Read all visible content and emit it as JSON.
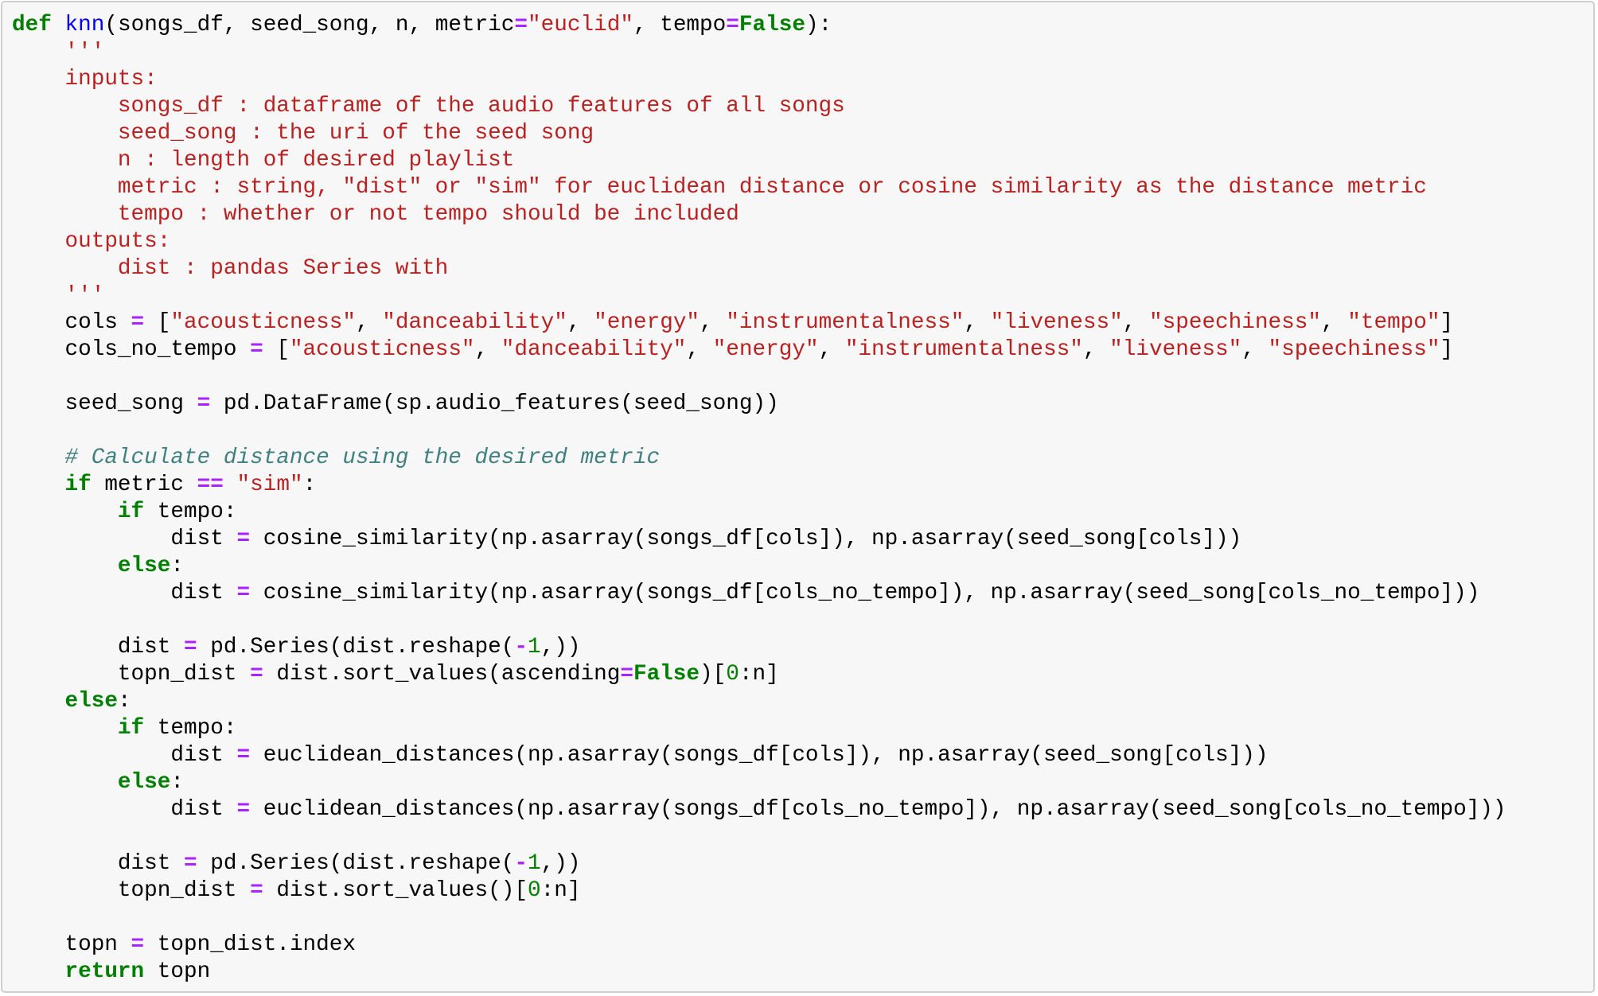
{
  "cell": {
    "language": "python",
    "colors": {
      "keyword": "#008000",
      "function_name": "#0000ff",
      "string": "#ba2121",
      "operator": "#aa22ff",
      "number": "#008000",
      "comment": "#408080",
      "background": "#f7f7f7",
      "border": "#cfcfcf"
    },
    "lines": [
      [
        [
          "kw",
          "def"
        ],
        [
          "pl",
          " "
        ],
        [
          "fn",
          "knn"
        ],
        [
          "pl",
          "(songs_df, seed_song, n, metric"
        ],
        [
          "op",
          "="
        ],
        [
          "str",
          "\"euclid\""
        ],
        [
          "pl",
          ", tempo"
        ],
        [
          "op",
          "="
        ],
        [
          "kw",
          "False"
        ],
        [
          "pl",
          "):"
        ]
      ],
      [
        [
          "pl",
          "    "
        ],
        [
          "str",
          "'''"
        ]
      ],
      [
        [
          "pl",
          "    "
        ],
        [
          "str",
          "inputs:"
        ]
      ],
      [
        [
          "pl",
          "        "
        ],
        [
          "str",
          "songs_df : dataframe of the audio features of all songs"
        ]
      ],
      [
        [
          "pl",
          "        "
        ],
        [
          "str",
          "seed_song : the uri of the seed song"
        ]
      ],
      [
        [
          "pl",
          "        "
        ],
        [
          "str",
          "n : length of desired playlist"
        ]
      ],
      [
        [
          "pl",
          "        "
        ],
        [
          "str",
          "metric : string, \"dist\" or \"sim\" for euclidean distance or cosine similarity as the distance metric"
        ]
      ],
      [
        [
          "pl",
          "        "
        ],
        [
          "str",
          "tempo : whether or not tempo should be included"
        ]
      ],
      [
        [
          "pl",
          "    "
        ],
        [
          "str",
          "outputs:"
        ]
      ],
      [
        [
          "pl",
          "        "
        ],
        [
          "str",
          "dist : pandas Series with"
        ]
      ],
      [
        [
          "pl",
          "    "
        ],
        [
          "str",
          "'''"
        ]
      ],
      [
        [
          "pl",
          "    cols "
        ],
        [
          "op",
          "="
        ],
        [
          "pl",
          " ["
        ],
        [
          "str",
          "\"acousticness\""
        ],
        [
          "pl",
          ", "
        ],
        [
          "str",
          "\"danceability\""
        ],
        [
          "pl",
          ", "
        ],
        [
          "str",
          "\"energy\""
        ],
        [
          "pl",
          ", "
        ],
        [
          "str",
          "\"instrumentalness\""
        ],
        [
          "pl",
          ", "
        ],
        [
          "str",
          "\"liveness\""
        ],
        [
          "pl",
          ", "
        ],
        [
          "str",
          "\"speechiness\""
        ],
        [
          "pl",
          ", "
        ],
        [
          "str",
          "\"tempo\""
        ],
        [
          "pl",
          "]"
        ]
      ],
      [
        [
          "pl",
          "    cols_no_tempo "
        ],
        [
          "op",
          "="
        ],
        [
          "pl",
          " ["
        ],
        [
          "str",
          "\"acousticness\""
        ],
        [
          "pl",
          ", "
        ],
        [
          "str",
          "\"danceability\""
        ],
        [
          "pl",
          ", "
        ],
        [
          "str",
          "\"energy\""
        ],
        [
          "pl",
          ", "
        ],
        [
          "str",
          "\"instrumentalness\""
        ],
        [
          "pl",
          ", "
        ],
        [
          "str",
          "\"liveness\""
        ],
        [
          "pl",
          ", "
        ],
        [
          "str",
          "\"speechiness\""
        ],
        [
          "pl",
          "]"
        ]
      ],
      [
        [
          "pl",
          ""
        ]
      ],
      [
        [
          "pl",
          "    seed_song "
        ],
        [
          "op",
          "="
        ],
        [
          "pl",
          " pd.DataFrame(sp.audio_features(seed_song))"
        ]
      ],
      [
        [
          "pl",
          ""
        ]
      ],
      [
        [
          "pl",
          "    "
        ],
        [
          "cm",
          "# Calculate distance using the desired metric"
        ]
      ],
      [
        [
          "pl",
          "    "
        ],
        [
          "kw",
          "if"
        ],
        [
          "pl",
          " metric "
        ],
        [
          "op",
          "=="
        ],
        [
          "pl",
          " "
        ],
        [
          "str",
          "\"sim\""
        ],
        [
          "pl",
          ":"
        ]
      ],
      [
        [
          "pl",
          "        "
        ],
        [
          "kw",
          "if"
        ],
        [
          "pl",
          " tempo:"
        ]
      ],
      [
        [
          "pl",
          "            dist "
        ],
        [
          "op",
          "="
        ],
        [
          "pl",
          " cosine_similarity(np.asarray(songs_df[cols]), np.asarray(seed_song[cols]))"
        ]
      ],
      [
        [
          "pl",
          "        "
        ],
        [
          "kw",
          "else"
        ],
        [
          "pl",
          ":"
        ]
      ],
      [
        [
          "pl",
          "            dist "
        ],
        [
          "op",
          "="
        ],
        [
          "pl",
          " cosine_similarity(np.asarray(songs_df[cols_no_tempo]), np.asarray(seed_song[cols_no_tempo]))"
        ]
      ],
      [
        [
          "pl",
          ""
        ]
      ],
      [
        [
          "pl",
          "        dist "
        ],
        [
          "op",
          "="
        ],
        [
          "pl",
          " pd.Series(dist.reshape("
        ],
        [
          "op",
          "-"
        ],
        [
          "num",
          "1"
        ],
        [
          "pl",
          ",))"
        ]
      ],
      [
        [
          "pl",
          "        topn_dist "
        ],
        [
          "op",
          "="
        ],
        [
          "pl",
          " dist.sort_values(ascending"
        ],
        [
          "op",
          "="
        ],
        [
          "kw",
          "False"
        ],
        [
          "pl",
          ")["
        ],
        [
          "num",
          "0"
        ],
        [
          "pl",
          ":n]"
        ]
      ],
      [
        [
          "pl",
          "    "
        ],
        [
          "kw",
          "else"
        ],
        [
          "pl",
          ":"
        ]
      ],
      [
        [
          "pl",
          "        "
        ],
        [
          "kw",
          "if"
        ],
        [
          "pl",
          " tempo:"
        ]
      ],
      [
        [
          "pl",
          "            dist "
        ],
        [
          "op",
          "="
        ],
        [
          "pl",
          " euclidean_distances(np.asarray(songs_df[cols]), np.asarray(seed_song[cols]))"
        ]
      ],
      [
        [
          "pl",
          "        "
        ],
        [
          "kw",
          "else"
        ],
        [
          "pl",
          ":"
        ]
      ],
      [
        [
          "pl",
          "            dist "
        ],
        [
          "op",
          "="
        ],
        [
          "pl",
          " euclidean_distances(np.asarray(songs_df[cols_no_tempo]), np.asarray(seed_song[cols_no_tempo]))"
        ]
      ],
      [
        [
          "pl",
          ""
        ]
      ],
      [
        [
          "pl",
          "        dist "
        ],
        [
          "op",
          "="
        ],
        [
          "pl",
          " pd.Series(dist.reshape("
        ],
        [
          "op",
          "-"
        ],
        [
          "num",
          "1"
        ],
        [
          "pl",
          ",))"
        ]
      ],
      [
        [
          "pl",
          "        topn_dist "
        ],
        [
          "op",
          "="
        ],
        [
          "pl",
          " dist.sort_values()["
        ],
        [
          "num",
          "0"
        ],
        [
          "pl",
          ":n]"
        ]
      ],
      [
        [
          "pl",
          ""
        ]
      ],
      [
        [
          "pl",
          "    topn "
        ],
        [
          "op",
          "="
        ],
        [
          "pl",
          " topn_dist.index"
        ]
      ],
      [
        [
          "pl",
          "    "
        ],
        [
          "kw",
          "return"
        ],
        [
          "pl",
          " topn"
        ]
      ]
    ]
  }
}
